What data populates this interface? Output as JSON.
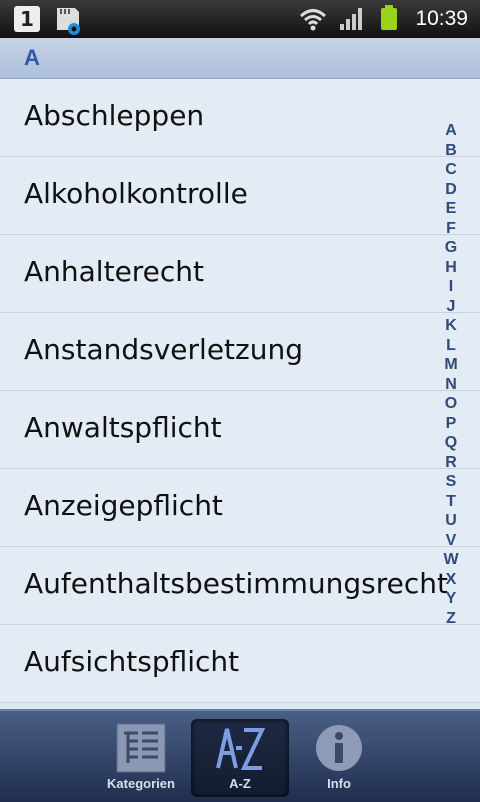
{
  "status_bar": {
    "notification_badge": "1",
    "time": "10:39",
    "icons": [
      "notification-count-icon",
      "sd-card-settings-icon",
      "wifi-icon",
      "signal-icon",
      "battery-icon"
    ]
  },
  "section_header": "A",
  "list": {
    "items": [
      "Abschleppen",
      "Alkoholkontrolle",
      "Anhalterecht",
      "Anstandsverletzung",
      "Anwaltspflicht",
      "Anzeigepflicht",
      "Aufenthaltsbestimmungsrecht",
      "Aufsichtspflicht"
    ]
  },
  "alpha_index": [
    "A",
    "B",
    "C",
    "D",
    "E",
    "F",
    "G",
    "H",
    "I",
    "J",
    "K",
    "L",
    "M",
    "N",
    "O",
    "P",
    "Q",
    "R",
    "S",
    "T",
    "U",
    "V",
    "W",
    "X",
    "Y",
    "Z"
  ],
  "tabs": [
    {
      "label": "Kategorien",
      "icon": "categories-icon"
    },
    {
      "label": "A-Z",
      "icon": "az-icon",
      "active": true
    },
    {
      "label": "Info",
      "icon": "info-icon"
    }
  ],
  "colors": {
    "accent": "#2f5aa8",
    "battery": "#9cd21c"
  }
}
